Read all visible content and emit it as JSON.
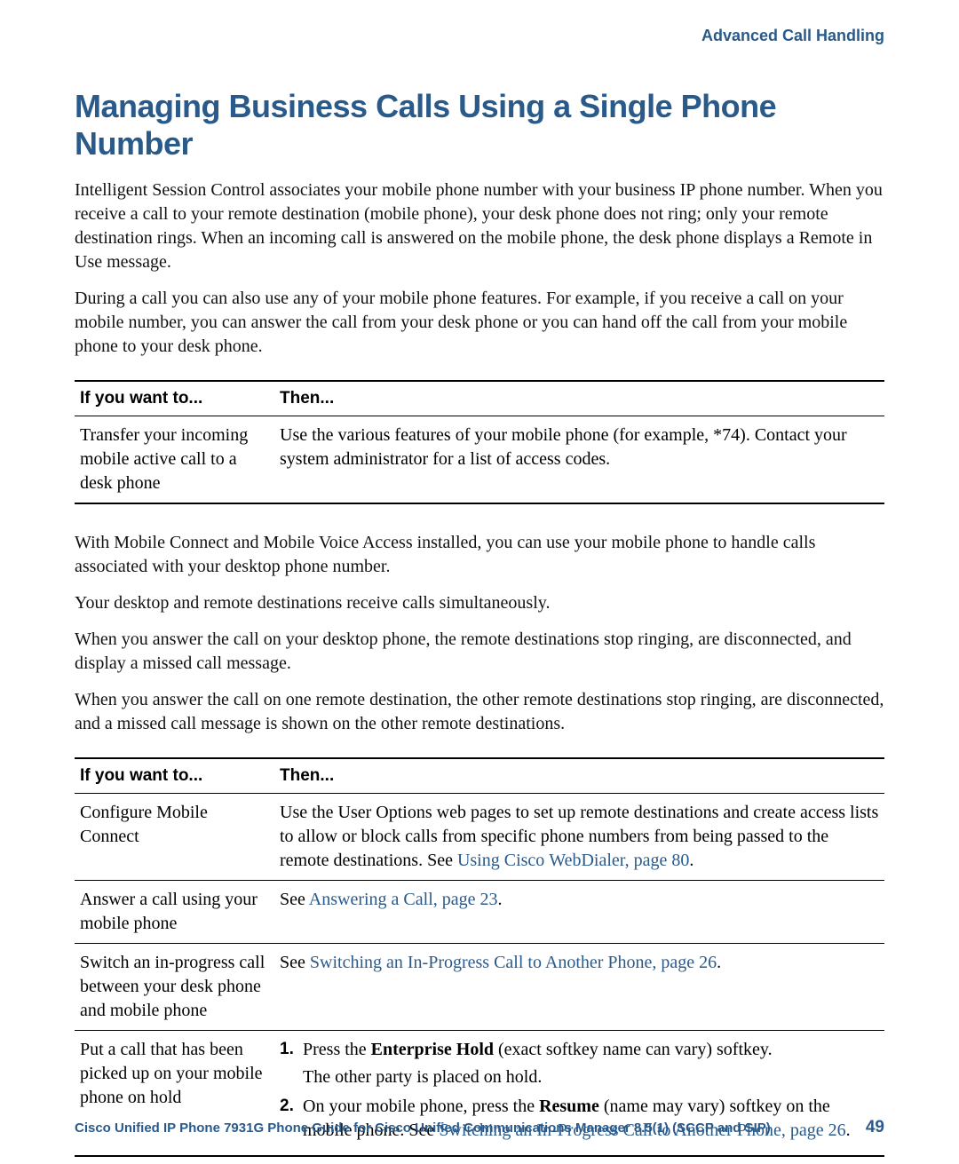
{
  "header": {
    "section": "Advanced Call Handling"
  },
  "heading": "Managing Business Calls Using a Single Phone Number",
  "paragraphs": {
    "p1": "Intelligent Session Control associates your mobile phone number with your business IP phone number. When you receive a call to your remote destination (mobile phone), your desk phone does not ring; only your remote destination rings. When an incoming call is answered on the mobile phone, the desk phone displays a Remote in Use message.",
    "p2": "During a call you can also use any of your mobile phone features. For example, if you receive a call on your mobile number, you can answer the call from your desk phone or you can hand off the call from your mobile phone to your desk phone.",
    "p3": "With Mobile Connect and Mobile Voice Access installed, you can use your mobile phone to handle calls associated with your desktop phone number.",
    "p4": "Your desktop and remote destinations receive calls simultaneously.",
    "p5": "When you answer the call on your desktop phone, the remote destinations stop ringing, are disconnected, and display a missed call message.",
    "p6": "When you answer the call on one remote destination, the other remote destinations stop ringing, are disconnected, and a missed call message is shown on the other remote destinations."
  },
  "table1": {
    "head": {
      "col1": "If you want to...",
      "col2": "Then..."
    },
    "rows": [
      {
        "want": "Transfer your incoming mobile active call to a desk phone",
        "then": "Use the various features of your mobile phone (for example, *74). Contact your system administrator for a list of access codes."
      }
    ]
  },
  "table2": {
    "head": {
      "col1": "If you want to...",
      "col2": "Then..."
    },
    "rows": [
      {
        "want": "Configure Mobile Connect",
        "then_pre": "Use the User Options web pages to set up remote destinations and create access lists to allow or block calls from specific phone numbers from being passed to the remote destinations. See ",
        "then_link": "Using Cisco WebDialer, page 80",
        "then_post": "."
      },
      {
        "want": "Answer a call using your mobile phone",
        "then_pre": "See ",
        "then_link": "Answering a Call, page 23",
        "then_post": "."
      },
      {
        "want": "Switch an in-progress call between your desk phone and mobile phone",
        "then_pre": "See ",
        "then_link": "Switching an In-Progress Call to Another Phone, page 26",
        "then_post": "."
      },
      {
        "want": "Put a call that has been picked up on your mobile phone on hold",
        "steps": [
          {
            "num": "1.",
            "pre": "Press the ",
            "bold": "Enterprise Hold",
            "post": " (exact softkey name can vary) softkey.",
            "sub": "The other party is placed on hold."
          },
          {
            "num": "2.",
            "pre": "On your mobile phone, press the ",
            "bold": "Resume",
            "post": " (name may vary) softkey on the mobile phone. See ",
            "link": "Switching an In-Progress Call to Another Phone, page 26",
            "post2": "."
          }
        ]
      }
    ]
  },
  "footer": {
    "title": "Cisco Unified IP Phone 7931G Phone Guide for Cisco Unified Communications Manager 8.5(1) (SCCP and SIP)",
    "page": "49"
  }
}
